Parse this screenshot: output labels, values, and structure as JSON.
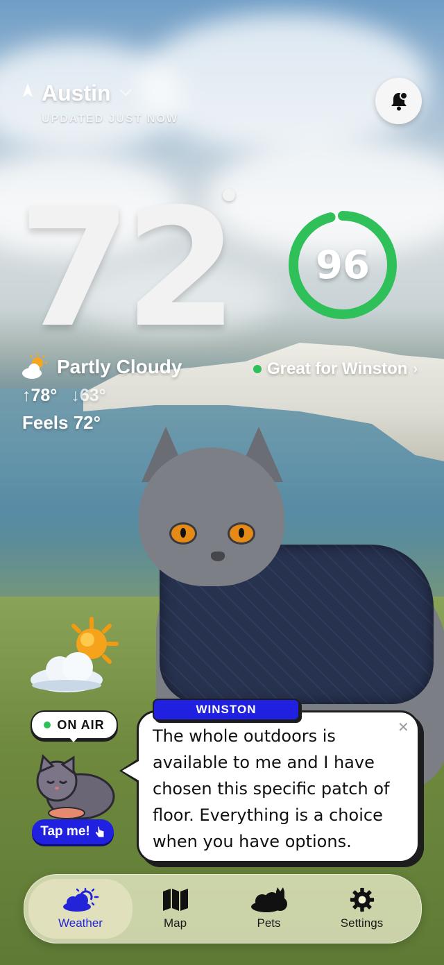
{
  "header": {
    "city": "Austin",
    "updated": "UPDATED JUST NOW",
    "location_icon": "location-arrow-icon",
    "dropdown_icon": "chevron-down-icon",
    "notification_icon": "bell-icon"
  },
  "current": {
    "temperature": "72",
    "condition": "Partly Cloudy",
    "high": "↑78°",
    "low": "↓63°",
    "feels_like": "Feels 72°",
    "condition_icon": "partly-cloudy-icon"
  },
  "pet_score": {
    "value": "96",
    "fraction": 0.96,
    "label": "Great for Winston",
    "color": "#2fc05a"
  },
  "mascot": {
    "on_air": "ON AIR",
    "tap_label": "Tap me!",
    "speaker": "WINSTON",
    "message": "The whole outdoors is available to me and I have chosen this specific patch of floor. Everything is a choice when you have options.",
    "close_icon": "close-icon"
  },
  "nav": {
    "items": [
      {
        "label": "Weather",
        "icon": "weather-icon",
        "active": true
      },
      {
        "label": "Map",
        "icon": "map-icon",
        "active": false
      },
      {
        "label": "Pets",
        "icon": "pets-icon",
        "active": false
      },
      {
        "label": "Settings",
        "icon": "gear-icon",
        "active": false
      }
    ],
    "active_color": "#2323d8"
  }
}
